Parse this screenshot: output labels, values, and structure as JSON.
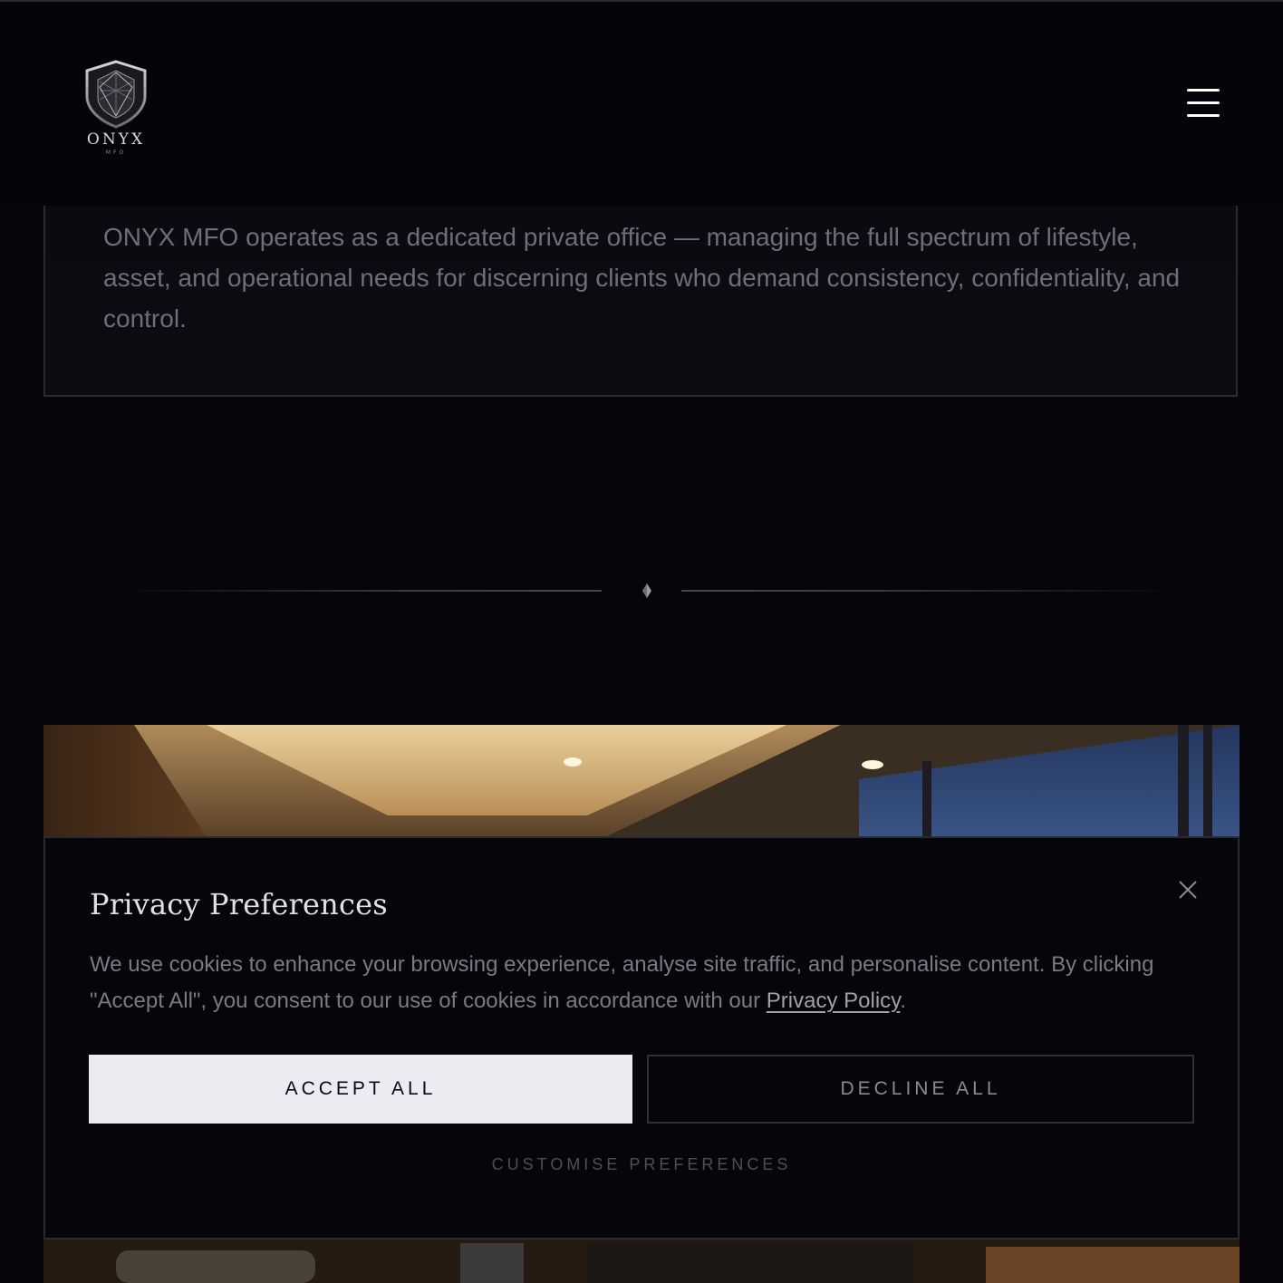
{
  "header": {
    "logo_name": "ONYX",
    "logo_sub": "MFO",
    "menu_icon": "hamburger-menu-icon"
  },
  "intro": {
    "text": "ONYX MFO operates as a dedicated private office — managing the full spectrum of lifestyle, asset, and operational needs for discerning clients who demand consistency, confidentiality, and control."
  },
  "divider": {
    "icon": "diamond-icon"
  },
  "cookie_banner": {
    "title": "Privacy Preferences",
    "body_before_link": "We use cookies to enhance your browsing experience, analyse site traffic, and personalise content. By clicking \"Accept All\", you consent to our use of cookies in accordance with our ",
    "link_label": "Privacy Policy",
    "body_after_link": ".",
    "accept_label": "ACCEPT ALL",
    "decline_label": "DECLINE ALL",
    "customise_label": "CUSTOMISE PREFERENCES",
    "close_icon": "close-icon"
  },
  "colors": {
    "background": "#05050a",
    "accept_button": "#ebebf2",
    "text_muted": "#7a7a84"
  }
}
